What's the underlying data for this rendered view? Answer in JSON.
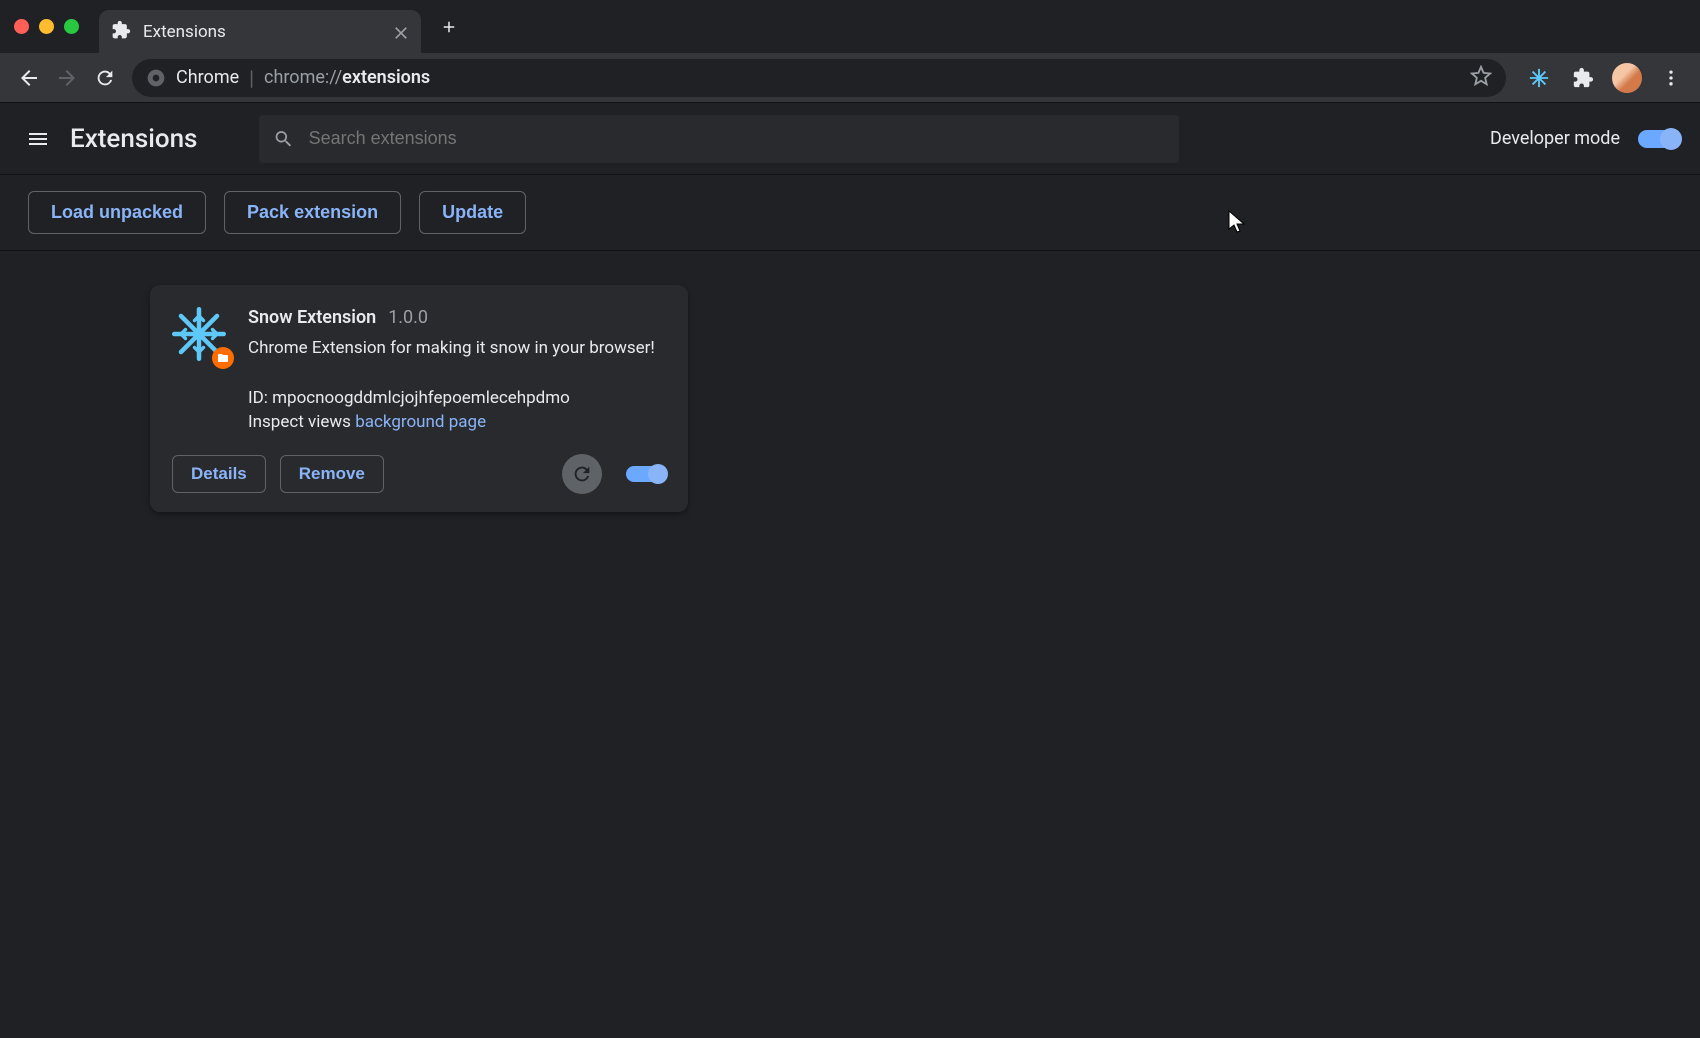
{
  "browser_tab": {
    "title": "Extensions"
  },
  "omnibox": {
    "chrome_label": "Chrome",
    "url_prefix": "chrome://",
    "url_main": "extensions"
  },
  "page": {
    "title": "Extensions",
    "search_placeholder": "Search extensions",
    "dev_mode_label": "Developer mode",
    "dev_mode_on": true
  },
  "dev_toolbar": {
    "load_unpacked": "Load unpacked",
    "pack_extension": "Pack extension",
    "update": "Update"
  },
  "extension": {
    "name": "Snow Extension",
    "version": "1.0.0",
    "description": "Chrome Extension for making it snow in your browser!",
    "id_label": "ID:",
    "id": "mpocnoogddmlcjojhfepoemlecehpdmo",
    "inspect_label": "Inspect views",
    "inspect_link": "background page",
    "details_label": "Details",
    "remove_label": "Remove",
    "enabled": true
  },
  "colors": {
    "accent": "#8ab4f8",
    "bg": "#202124",
    "card": "#292a2d"
  }
}
